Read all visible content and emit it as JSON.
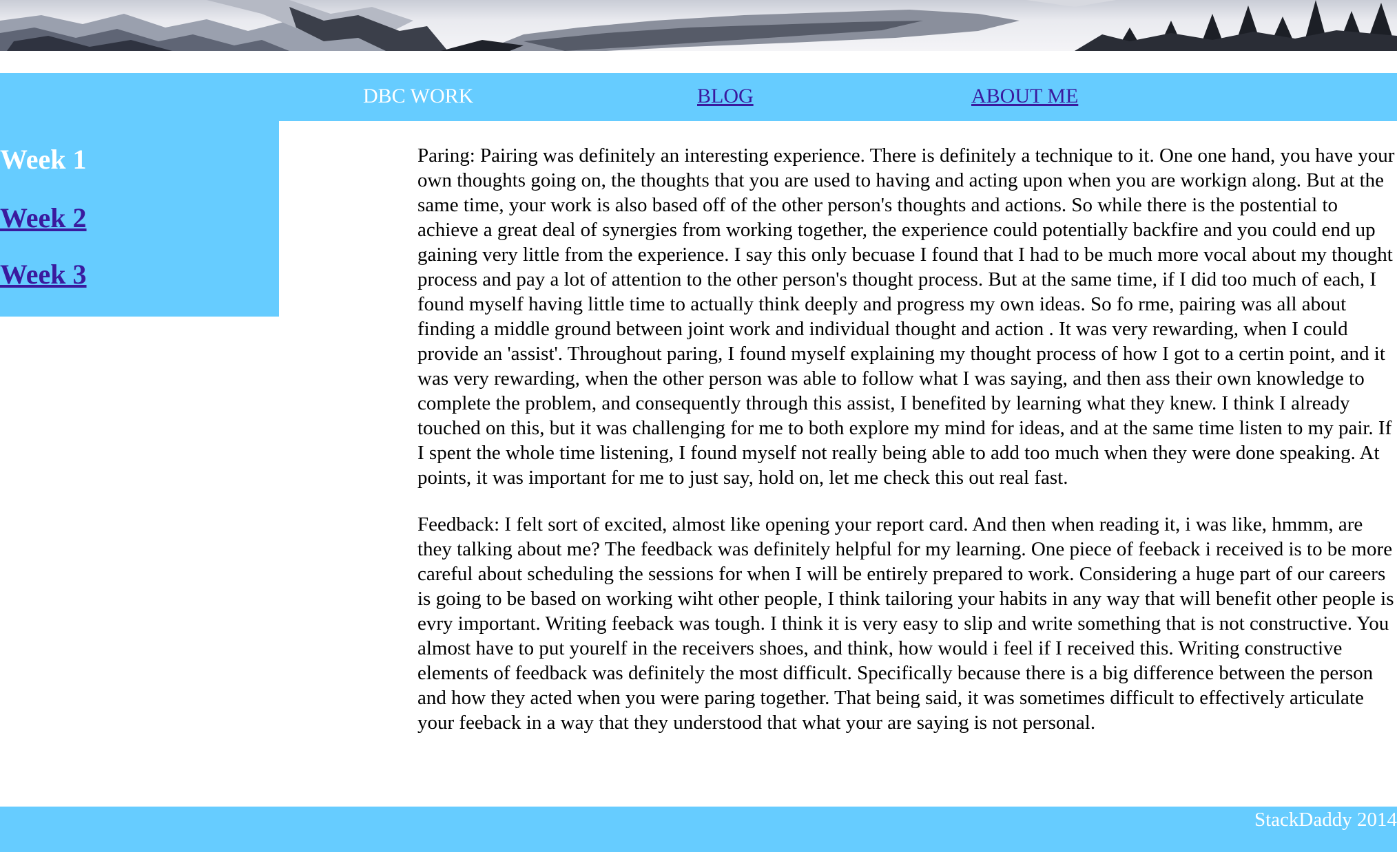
{
  "nav": {
    "dbc_work": "DBC WORK",
    "blog": "BLOG",
    "about_me": "ABOUT ME"
  },
  "sidebar": {
    "items": [
      {
        "label": "Week 1",
        "current": true
      },
      {
        "label": "Week 2",
        "current": false
      },
      {
        "label": "Week 3",
        "current": false
      }
    ]
  },
  "main": {
    "paragraphs": [
      "Paring: Pairing was definitely an interesting experience. There is definitely a technique to it. One one hand, you have your own thoughts going on, the thoughts that you are used to having and acting upon when you are workign along. But at the same time, your work is also based off of the other person's thoughts and actions. So while there is the postential to achieve a great deal of synergies from working together, the experience could potentially backfire and you could end up gaining very little from the experience. I say this only becuase I found that I had to be much more vocal about my thought process and pay a lot of attention to the other person's thought process. But at the same time, if I did too much of each, I found myself having little time to actually think deeply and progress my own ideas. So fo rme, pairing was all about finding a middle ground between joint work and individual thought and action . It was very rewarding, when I could provide an 'assist'. Throughout paring, I found myself explaining my thought process of how I got to a certin point, and it was very rewarding, when the other person was able to follow what I was saying, and then ass their own knowledge to complete the problem, and consequently through this assist, I benefited by learning what they knew. I think I already touched on this, but it was challenging for me to both explore my mind for ideas, and at the same time listen to my pair. If I spent the whole time listening, I found myself not really being able to add too much when they were done speaking. At points, it was important for me to just say, hold on, let me check this out real fast.",
      "Feedback: I felt sort of excited, almost like opening your report card. And then when reading it, i was like, hmmm, are they talking about me? The feedback was definitely helpful for my learning. One piece of feeback i received is to be more careful about scheduling the sessions for when I will be entirely prepared to work. Considering a huge part of our careers is going to be based on working wiht other people, I think tailoring your habits in any way that will benefit other people is evry important. Writing feeback was tough. I think it is very easy to slip and write something that is not constructive. You almost have to put yourelf in the receivers shoes, and think, how would i feel if I received this. Writing constructive elements of feedback was definitely the most difficult. Specifically because there is a big difference between the person and how they acted when you were paring together. That being said, it was sometimes difficult to effectively articulate your feeback in a way that they understood that what your are saying is not personal."
    ]
  },
  "footer": {
    "text": "StackDaddy 2014"
  },
  "colors": {
    "bar_background": "#66ccff",
    "link": "#3a1a9e",
    "current_text": "#ffffff",
    "body_text": "#000000"
  },
  "banner": {
    "image": "snowy-mountain-landscape"
  }
}
